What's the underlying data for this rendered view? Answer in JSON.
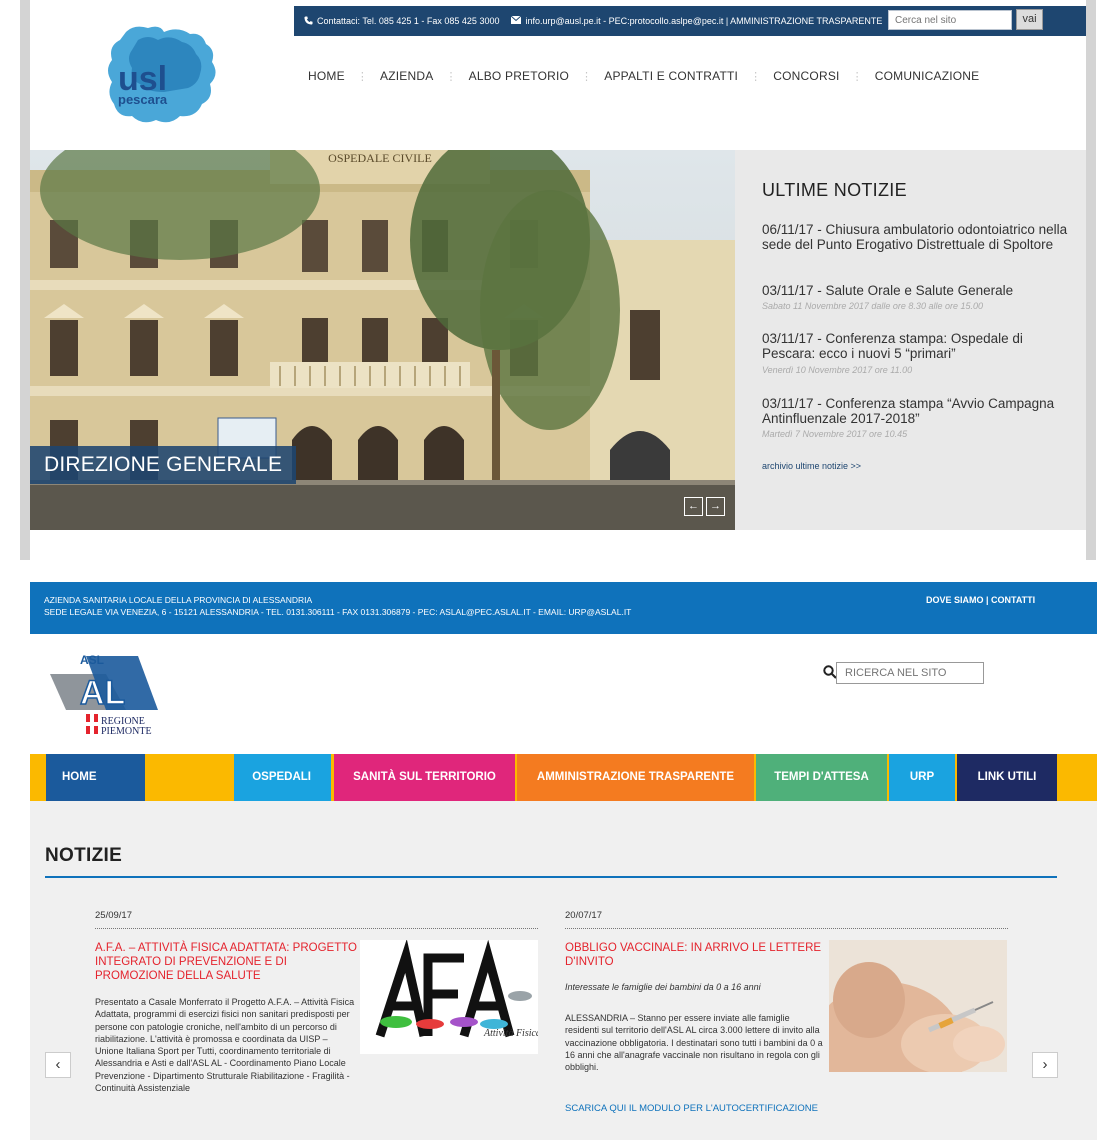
{
  "site1": {
    "topbar": {
      "contact": "Contattaci: Tel. 085 425 1 - Fax 085 425 3000",
      "email": "info.urp@ausl.pe.it - PEC:protocollo.aslpe@pec.it | AMMINISTRAZIONE TRASPARENTE",
      "search_placeholder": "Cerca nel sito",
      "search_button": "vai"
    },
    "logo_text": "usl pescara",
    "nav": [
      "HOME",
      "AZIENDA",
      "ALBO PRETORIO",
      "APPALTI E CONTRATTI",
      "CONCORSI",
      "COMUNICAZIONE"
    ],
    "hero": {
      "building_sign": "OSPEDALE CIVILE",
      "caption": "DIREZIONE GENERALE",
      "prev": "←",
      "next": "→"
    },
    "news": {
      "title": "ULTIME NOTIZIE",
      "items": [
        {
          "headline": "06/11/17 - Chiusura ambulatorio odontoiatrico nella sede del Punto Erogativo Distrettuale di Spoltore",
          "sub": ""
        },
        {
          "headline": "03/11/17 - Salute Orale e Salute Generale",
          "sub": "Sabato 11 Novembre 2017 dalle ore 8.30 alle ore 15.00"
        },
        {
          "headline": "03/11/17 - Conferenza stampa: Ospedale di Pescara: ecco i nuovi 5 “primari”",
          "sub": "Venerdì 10 Novembre 2017 ore 11.00"
        },
        {
          "headline": "03/11/17 - Conferenza stampa “Avvio Campagna Antinfluenzale 2017-2018”",
          "sub": "Martedì 7 Novembre 2017 ore 10.45"
        }
      ],
      "archive": "archivio ultime notizie >>"
    }
  },
  "site2": {
    "topbar": {
      "line1": "AZIENDA SANITARIA LOCALE DELLA PROVINCIA DI ALESSANDRIA",
      "line2": "SEDE LEGALE VIA VENEZIA, 6 - 15121 ALESSANDRIA - TEL. 0131.306111 - FAX 0131.306879 - PEC: ASLAL@PEC.ASLAL.IT - EMAIL: URP@ASLAL.IT",
      "links": "DOVE SIAMO | CONTATTI"
    },
    "logo": {
      "asl": "ASL",
      "al": "AL",
      "regione": "REGIONE",
      "piemonte": "PIEMONTE"
    },
    "search_placeholder": "RICERCA NEL SITO",
    "menu": [
      {
        "label": "HOME",
        "color": "#1b5a9c"
      },
      {
        "label": "OSPEDALI",
        "color": "#1aa3e0"
      },
      {
        "label": "SANITÀ SUL TERRITORIO",
        "color": "#e0267b"
      },
      {
        "label": "AMMINISTRAZIONE TRASPARENTE",
        "color": "#f47b20"
      },
      {
        "label": "TEMPI D'ATTESA",
        "color": "#4fb07a"
      },
      {
        "label": "URP",
        "color": "#1aa3e0"
      },
      {
        "label": "LINK UTILI",
        "color": "#1e2a63"
      }
    ],
    "menu_bg": "#fbb900",
    "section_title": "NOTIZIE",
    "news": [
      {
        "date": "25/09/17",
        "title": "A.F.A. – ATTIVITÀ FISICA ADATTATA: PROGETTO INTEGRATO DI PREVENZIONE E DI PROMOZIONE DELLA SALUTE",
        "body": "Presentato a Casale Monferrato il Progetto  A.F.A. – Attività Fisica Adattata,  programmi di esercizi fisici non sanitari predisposti per persone con patologie croniche, nell'ambito di un percorso di riabilitazione. L'attività è promossa e coordinata da UISP – Unione Italiana Sport per Tutti, coordinamento territoriale di Alessandria e Asti e dall'ASL AL - Coordinamento Piano Locale Prevenzione - Dipartimento Strutturale Riabilitazione - Fragilità - Continuità Assistenziale",
        "image_caption": "Attività Fisica Adattata"
      },
      {
        "date": "20/07/17",
        "title": "OBBLIGO VACCINALE: IN ARRIVO LE LETTERE D'INVITO",
        "subtitle": "Interessate le famiglie dei bambini da 0 a 16 anni",
        "body": "ALESSANDRIA – Stanno per essere inviate alle famiglie residenti sul territorio dell'ASL AL circa 3.000 lettere di invito alla vaccinazione obbligatoria. I destinatari sono tutti i bambini da 0 a 16 anni che all'anagrafe vaccinale non risultano in regola con gli obblighi.",
        "link": "SCARICA QUI IL MODULO PER L'AUTOCERTIFICAZIONE"
      }
    ],
    "carousel_prev": "‹",
    "carousel_next": "›"
  }
}
